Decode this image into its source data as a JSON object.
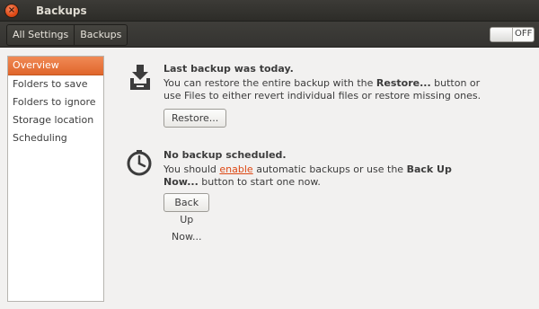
{
  "window": {
    "title": "Backups",
    "close_symbol": "×"
  },
  "toolbar": {
    "breadcrumbs": [
      "All Settings",
      "Backups"
    ],
    "switch_label": "OFF"
  },
  "sidebar": {
    "items": [
      "Overview",
      "Folders to save",
      "Folders to ignore",
      "Storage location",
      "Scheduling"
    ],
    "selected": "Overview"
  },
  "restore_section": {
    "heading": "Last backup was today.",
    "text_before": "You can restore the entire backup with the ",
    "text_bold": "Restore...",
    "text_after": " button or use Files to either revert individual files or restore missing ones.",
    "button_label": "Restore..."
  },
  "schedule_section": {
    "heading": "No backup scheduled.",
    "text_before": "You should ",
    "link_text": "enable",
    "text_middle": " automatic backups or use the ",
    "text_bold": "Back Up Now...",
    "text_after": " button to start one now.",
    "button_label": "Back Up Now..."
  },
  "colors": {
    "accent": "#e0662c",
    "link": "#dd4814",
    "titlebar": "#3c3b37"
  }
}
